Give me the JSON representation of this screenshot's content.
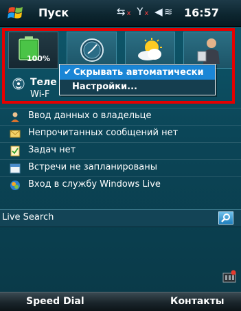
{
  "status_bar": {
    "start_label": "Пуск",
    "time": "16:57",
    "icons": [
      "connectivity-off-icon",
      "signal-off-icon",
      "volume-icon"
    ]
  },
  "tiles": [
    {
      "name": "battery",
      "text": "100%"
    },
    {
      "name": "clock"
    },
    {
      "name": "weather"
    },
    {
      "name": "contacts"
    }
  ],
  "comm_row": {
    "title": "Теле",
    "subtitle": "Wi-F"
  },
  "context_menu": {
    "items": [
      {
        "label": "Скрывать автоматически",
        "checked": true
      },
      {
        "label": "Настройки...",
        "checked": false
      }
    ]
  },
  "list": [
    {
      "icon": "owner-icon",
      "label": "Ввод данных о владельце"
    },
    {
      "icon": "mail-icon",
      "label": "Непрочитанных сообщений нет"
    },
    {
      "icon": "task-icon",
      "label": "Задач нет"
    },
    {
      "icon": "calendar-icon",
      "label": "Встречи не запланированы"
    },
    {
      "icon": "windows-live-icon",
      "label": "Вход в службу Windows Live"
    }
  ],
  "search": {
    "label": "Live Search"
  },
  "softkeys": {
    "left": "Speed Dial",
    "right": "Контакты"
  },
  "colors": {
    "highlight_box": "#e60000",
    "menu_selection": "#1a86d6",
    "background": "#0b4557"
  }
}
